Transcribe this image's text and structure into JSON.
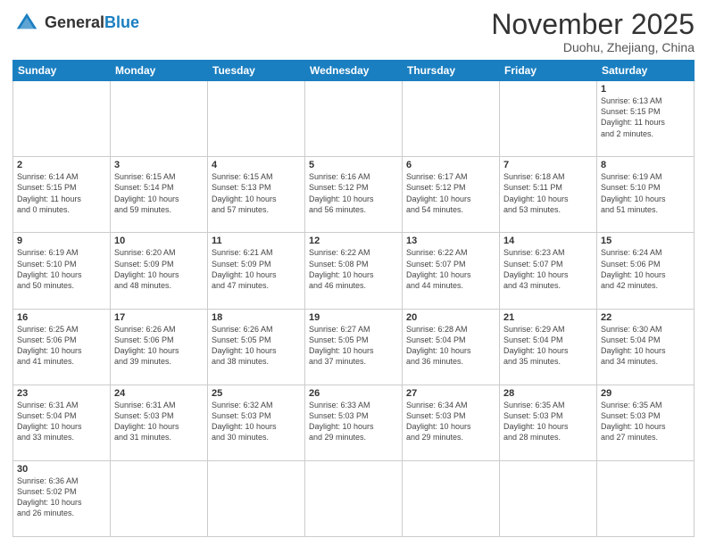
{
  "logo": {
    "general": "General",
    "blue": "Blue"
  },
  "header": {
    "month": "November 2025",
    "location": "Duohu, Zhejiang, China"
  },
  "days_of_week": [
    "Sunday",
    "Monday",
    "Tuesday",
    "Wednesday",
    "Thursday",
    "Friday",
    "Saturday"
  ],
  "weeks": [
    [
      {
        "day": "",
        "info": ""
      },
      {
        "day": "",
        "info": ""
      },
      {
        "day": "",
        "info": ""
      },
      {
        "day": "",
        "info": ""
      },
      {
        "day": "",
        "info": ""
      },
      {
        "day": "",
        "info": ""
      },
      {
        "day": "1",
        "info": "Sunrise: 6:13 AM\nSunset: 5:15 PM\nDaylight: 11 hours\nand 2 minutes."
      }
    ],
    [
      {
        "day": "2",
        "info": "Sunrise: 6:14 AM\nSunset: 5:15 PM\nDaylight: 11 hours\nand 0 minutes."
      },
      {
        "day": "3",
        "info": "Sunrise: 6:15 AM\nSunset: 5:14 PM\nDaylight: 10 hours\nand 59 minutes."
      },
      {
        "day": "4",
        "info": "Sunrise: 6:15 AM\nSunset: 5:13 PM\nDaylight: 10 hours\nand 57 minutes."
      },
      {
        "day": "5",
        "info": "Sunrise: 6:16 AM\nSunset: 5:12 PM\nDaylight: 10 hours\nand 56 minutes."
      },
      {
        "day": "6",
        "info": "Sunrise: 6:17 AM\nSunset: 5:12 PM\nDaylight: 10 hours\nand 54 minutes."
      },
      {
        "day": "7",
        "info": "Sunrise: 6:18 AM\nSunset: 5:11 PM\nDaylight: 10 hours\nand 53 minutes."
      },
      {
        "day": "8",
        "info": "Sunrise: 6:19 AM\nSunset: 5:10 PM\nDaylight: 10 hours\nand 51 minutes."
      }
    ],
    [
      {
        "day": "9",
        "info": "Sunrise: 6:19 AM\nSunset: 5:10 PM\nDaylight: 10 hours\nand 50 minutes."
      },
      {
        "day": "10",
        "info": "Sunrise: 6:20 AM\nSunset: 5:09 PM\nDaylight: 10 hours\nand 48 minutes."
      },
      {
        "day": "11",
        "info": "Sunrise: 6:21 AM\nSunset: 5:09 PM\nDaylight: 10 hours\nand 47 minutes."
      },
      {
        "day": "12",
        "info": "Sunrise: 6:22 AM\nSunset: 5:08 PM\nDaylight: 10 hours\nand 46 minutes."
      },
      {
        "day": "13",
        "info": "Sunrise: 6:22 AM\nSunset: 5:07 PM\nDaylight: 10 hours\nand 44 minutes."
      },
      {
        "day": "14",
        "info": "Sunrise: 6:23 AM\nSunset: 5:07 PM\nDaylight: 10 hours\nand 43 minutes."
      },
      {
        "day": "15",
        "info": "Sunrise: 6:24 AM\nSunset: 5:06 PM\nDaylight: 10 hours\nand 42 minutes."
      }
    ],
    [
      {
        "day": "16",
        "info": "Sunrise: 6:25 AM\nSunset: 5:06 PM\nDaylight: 10 hours\nand 41 minutes."
      },
      {
        "day": "17",
        "info": "Sunrise: 6:26 AM\nSunset: 5:06 PM\nDaylight: 10 hours\nand 39 minutes."
      },
      {
        "day": "18",
        "info": "Sunrise: 6:26 AM\nSunset: 5:05 PM\nDaylight: 10 hours\nand 38 minutes."
      },
      {
        "day": "19",
        "info": "Sunrise: 6:27 AM\nSunset: 5:05 PM\nDaylight: 10 hours\nand 37 minutes."
      },
      {
        "day": "20",
        "info": "Sunrise: 6:28 AM\nSunset: 5:04 PM\nDaylight: 10 hours\nand 36 minutes."
      },
      {
        "day": "21",
        "info": "Sunrise: 6:29 AM\nSunset: 5:04 PM\nDaylight: 10 hours\nand 35 minutes."
      },
      {
        "day": "22",
        "info": "Sunrise: 6:30 AM\nSunset: 5:04 PM\nDaylight: 10 hours\nand 34 minutes."
      }
    ],
    [
      {
        "day": "23",
        "info": "Sunrise: 6:31 AM\nSunset: 5:04 PM\nDaylight: 10 hours\nand 33 minutes."
      },
      {
        "day": "24",
        "info": "Sunrise: 6:31 AM\nSunset: 5:03 PM\nDaylight: 10 hours\nand 31 minutes."
      },
      {
        "day": "25",
        "info": "Sunrise: 6:32 AM\nSunset: 5:03 PM\nDaylight: 10 hours\nand 30 minutes."
      },
      {
        "day": "26",
        "info": "Sunrise: 6:33 AM\nSunset: 5:03 PM\nDaylight: 10 hours\nand 29 minutes."
      },
      {
        "day": "27",
        "info": "Sunrise: 6:34 AM\nSunset: 5:03 PM\nDaylight: 10 hours\nand 29 minutes."
      },
      {
        "day": "28",
        "info": "Sunrise: 6:35 AM\nSunset: 5:03 PM\nDaylight: 10 hours\nand 28 minutes."
      },
      {
        "day": "29",
        "info": "Sunrise: 6:35 AM\nSunset: 5:03 PM\nDaylight: 10 hours\nand 27 minutes."
      }
    ],
    [
      {
        "day": "30",
        "info": "Sunrise: 6:36 AM\nSunset: 5:02 PM\nDaylight: 10 hours\nand 26 minutes."
      },
      {
        "day": "",
        "info": ""
      },
      {
        "day": "",
        "info": ""
      },
      {
        "day": "",
        "info": ""
      },
      {
        "day": "",
        "info": ""
      },
      {
        "day": "",
        "info": ""
      },
      {
        "day": "",
        "info": ""
      }
    ]
  ]
}
